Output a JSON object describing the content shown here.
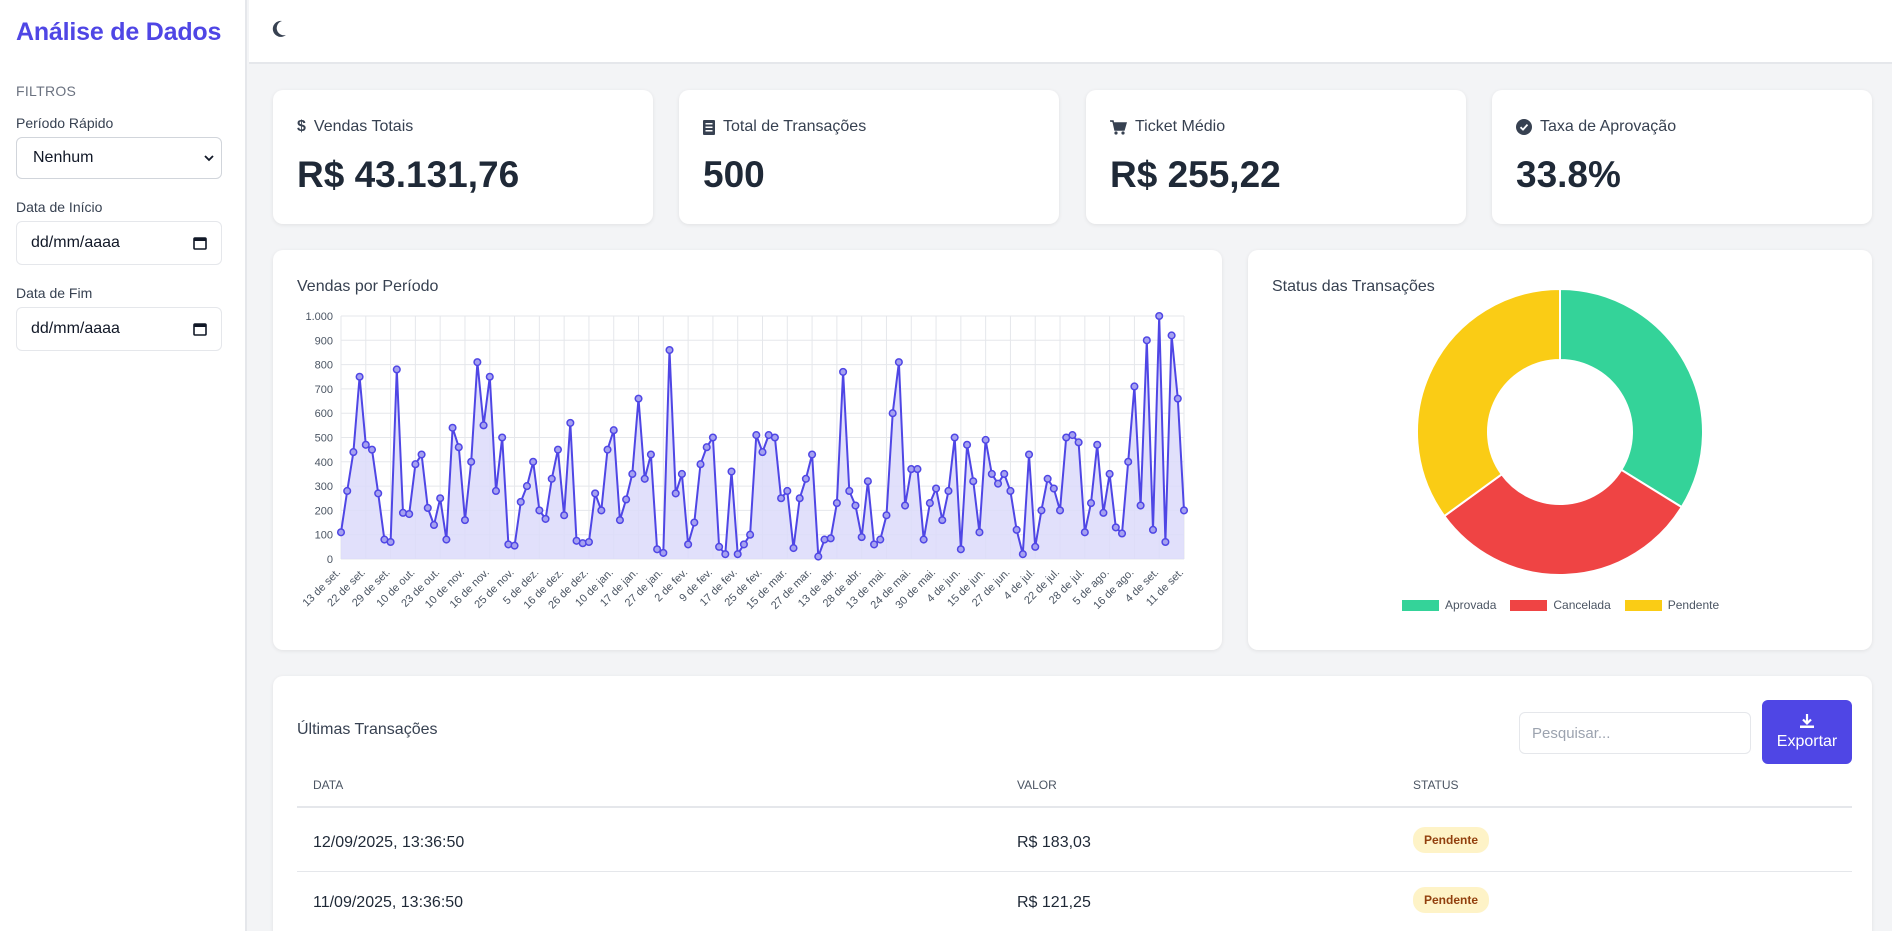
{
  "app": {
    "title": "Análise de Dados"
  },
  "sidebar": {
    "section_label": "FILTROS",
    "quick_period": {
      "label": "Período Rápido",
      "value": "Nenhum"
    },
    "start_date": {
      "label": "Data de Início",
      "placeholder": "dd/mm/aaaa"
    },
    "end_date": {
      "label": "Data de Fim",
      "placeholder": "dd/mm/aaaa"
    }
  },
  "topbar": {
    "theme_icon": "moon-icon"
  },
  "kpis": [
    {
      "title": "Vendas Totais",
      "value": "R$ 43.131,76",
      "icon": "dollar-icon"
    },
    {
      "title": "Total de Transações",
      "value": "500",
      "icon": "receipt-icon"
    },
    {
      "title": "Ticket Médio",
      "value": "R$ 255,22",
      "icon": "cart-icon"
    },
    {
      "title": "Taxa de Aprovação",
      "value": "33.8%",
      "icon": "check-circle-icon"
    }
  ],
  "charts": {
    "sales_title": "Vendas por Período",
    "status_title": "Status das Transações"
  },
  "chart_data": [
    {
      "type": "area",
      "title": "Vendas por Período",
      "ylim": [
        0,
        1000
      ],
      "yticks": [
        "0",
        "100",
        "200",
        "300",
        "400",
        "500",
        "600",
        "700",
        "800",
        "900",
        "1.000"
      ],
      "grid": true,
      "color": "#4f46e5",
      "fill": "#dcdafa",
      "xtick_labels": [
        "13 de set.",
        "22 de set.",
        "29 de set.",
        "10 de out.",
        "23 de out.",
        "10 de nov.",
        "16 de nov.",
        "25 de nov.",
        "5 de dez.",
        "16 de dez.",
        "26 de dez.",
        "10 de jan.",
        "17 de jan.",
        "27 de jan.",
        "2 de fev.",
        "9 de fev.",
        "17 de fev.",
        "25 de fev.",
        "15 de mar.",
        "27 de mar.",
        "13 de abr.",
        "28 de abr.",
        "13 de mai.",
        "24 de mai.",
        "30 de mai.",
        "4 de jun.",
        "15 de jun.",
        "27 de jun.",
        "4 de jul.",
        "22 de jul.",
        "28 de jul.",
        "5 de ago.",
        "16 de ago.",
        "4 de set.",
        "11 de set."
      ],
      "values": [
        110,
        280,
        440,
        750,
        470,
        450,
        270,
        80,
        70,
        780,
        190,
        185,
        390,
        430,
        210,
        140,
        250,
        80,
        540,
        460,
        160,
        400,
        810,
        550,
        750,
        280,
        500,
        60,
        55,
        235,
        300,
        400,
        200,
        165,
        330,
        450,
        180,
        560,
        75,
        65,
        70,
        270,
        200,
        450,
        530,
        160,
        245,
        350,
        660,
        330,
        430,
        40,
        25,
        860,
        270,
        350,
        60,
        150,
        390,
        460,
        500,
        50,
        20,
        360,
        20,
        60,
        100,
        510,
        440,
        510,
        500,
        250,
        280,
        45,
        250,
        330,
        430,
        10,
        80,
        85,
        230,
        770,
        280,
        220,
        90,
        320,
        60,
        80,
        180,
        600,
        810,
        220,
        370,
        370,
        80,
        230,
        290,
        160,
        280,
        500,
        40,
        470,
        320,
        110,
        490,
        350,
        310,
        350,
        280,
        120,
        20,
        430,
        50,
        200,
        330,
        290,
        200,
        500,
        510,
        480,
        110,
        230,
        470,
        190,
        350,
        130,
        105,
        400,
        710,
        220,
        900,
        120,
        1000,
        70,
        920,
        660,
        200
      ]
    },
    {
      "type": "pie",
      "title": "Status das Transações",
      "donut": true,
      "categories": [
        "Aprovada",
        "Cancelada",
        "Pendente"
      ],
      "values": [
        33.8,
        31.2,
        35.0
      ],
      "colors": [
        "#34d399",
        "#ef4444",
        "#facc15"
      ],
      "legend": "bottom"
    }
  ],
  "transactions": {
    "title": "Últimas Transações",
    "search_placeholder": "Pesquisar...",
    "export_label": "Exportar",
    "columns": [
      "DATA",
      "VALOR",
      "STATUS"
    ],
    "rows": [
      {
        "date": "12/09/2025, 13:36:50",
        "value": "R$ 183,03",
        "status": "Pendente"
      },
      {
        "date": "11/09/2025, 13:36:50",
        "value": "R$ 121,25",
        "status": "Pendente"
      }
    ]
  }
}
